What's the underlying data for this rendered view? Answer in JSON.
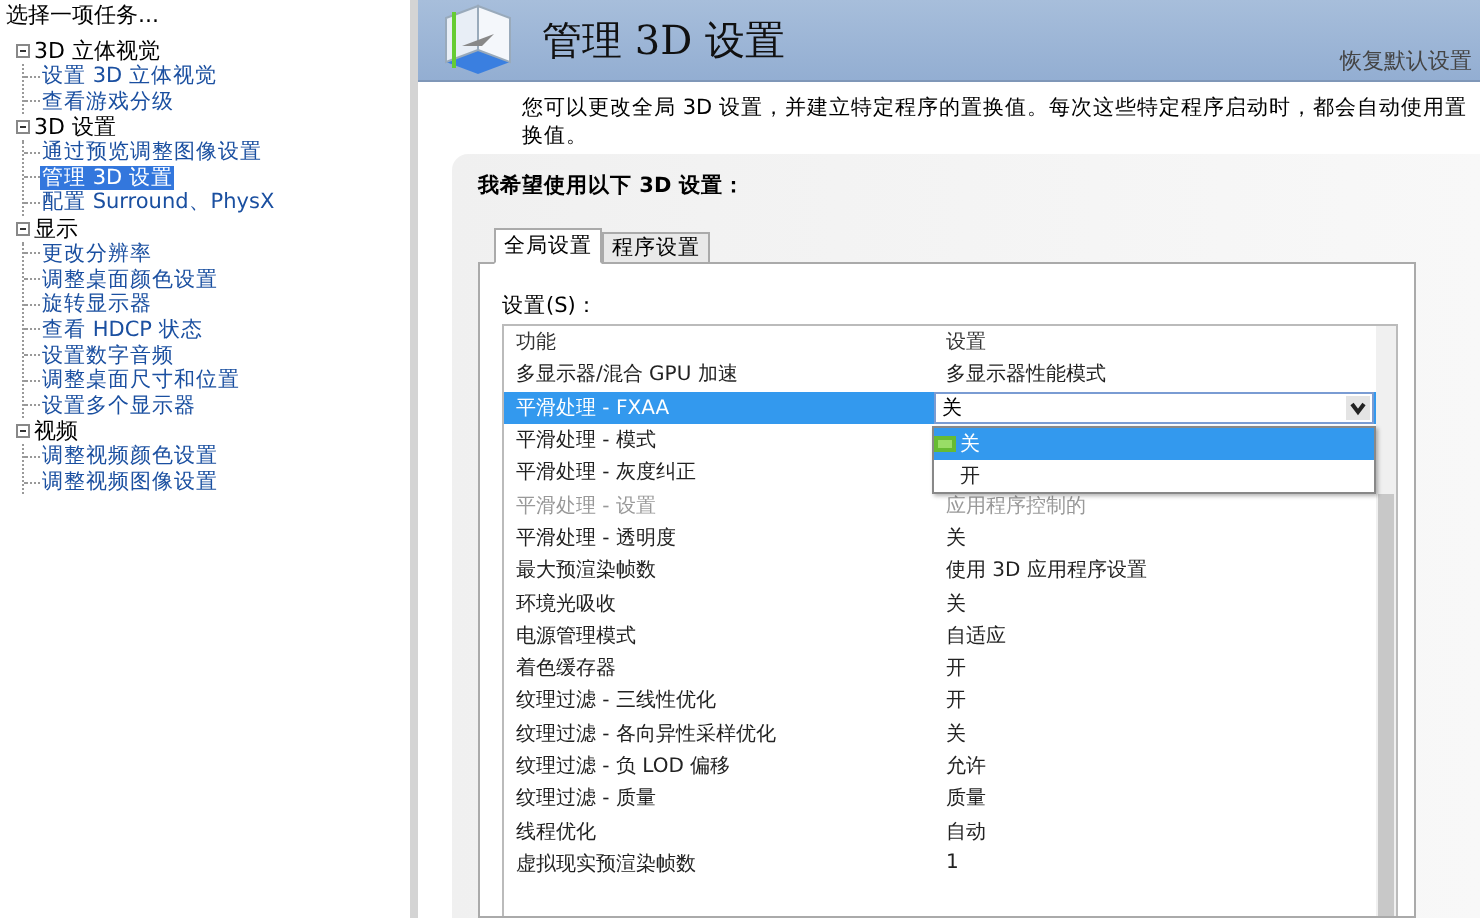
{
  "sidebar": {
    "title": "选择一项任务...",
    "tree": [
      {
        "label": "3D 立体视觉",
        "expanded": true,
        "children": [
          {
            "label": "设置 3D 立体视觉",
            "selected": false
          },
          {
            "label": "查看游戏分级",
            "selected": false
          }
        ]
      },
      {
        "label": "3D 设置",
        "expanded": true,
        "children": [
          {
            "label": "通过预览调整图像设置",
            "selected": false
          },
          {
            "label": "管理 3D 设置",
            "selected": true
          },
          {
            "label": "配置 Surround、PhysX",
            "selected": false
          }
        ]
      },
      {
        "label": "显示",
        "expanded": true,
        "children": [
          {
            "label": "更改分辨率",
            "selected": false
          },
          {
            "label": "调整桌面颜色设置",
            "selected": false
          },
          {
            "label": "旋转显示器",
            "selected": false
          },
          {
            "label": "查看 HDCP 状态",
            "selected": false
          },
          {
            "label": "设置数字音频",
            "selected": false
          },
          {
            "label": "调整桌面尺寸和位置",
            "selected": false
          },
          {
            "label": "设置多个显示器",
            "selected": false
          }
        ]
      },
      {
        "label": "视频",
        "expanded": true,
        "children": [
          {
            "label": "调整视频颜色设置",
            "selected": false
          },
          {
            "label": "调整视频图像设置",
            "selected": false
          }
        ]
      }
    ]
  },
  "header": {
    "title": "管理 3D 设置",
    "restore_link": "恢复默认设置"
  },
  "description": "您可以更改全局 3D 设置，并建立特定程序的置换值。每次这些特定程序启动时，都会自动使用置换值。",
  "group": {
    "title": "我希望使用以下 3D 设置：",
    "tabs": [
      {
        "label": "全局设置",
        "selected": true
      },
      {
        "label": "程序设置",
        "selected": false
      }
    ],
    "settings_label": "设置(S)：",
    "table": {
      "columns": [
        "功能",
        "设置"
      ],
      "rows": [
        {
          "feature": "多显示器/混合 GPU 加速",
          "setting": "多显示器性能模式",
          "selected": false,
          "disabled": false
        },
        {
          "feature": "平滑处理 - FXAA",
          "setting": "关",
          "selected": true,
          "disabled": false
        },
        {
          "feature": "平滑处理 - 模式",
          "selected": false,
          "disabled": false
        },
        {
          "feature": "平滑处理 - 灰度纠正",
          "selected": false,
          "disabled": false
        },
        {
          "feature": "平滑处理 - 设置",
          "setting": "应用程序控制的",
          "selected": false,
          "disabled": true
        },
        {
          "feature": "平滑处理 - 透明度",
          "setting": "关",
          "selected": false,
          "disabled": false
        },
        {
          "feature": "最大预渲染帧数",
          "setting": "使用 3D 应用程序设置",
          "selected": false,
          "disabled": false
        },
        {
          "feature": "环境光吸收",
          "setting": "关",
          "selected": false,
          "disabled": false
        },
        {
          "feature": "电源管理模式",
          "setting": "自适应",
          "selected": false,
          "disabled": false
        },
        {
          "feature": "着色缓存器",
          "setting": "开",
          "selected": false,
          "disabled": false
        },
        {
          "feature": "纹理过滤 - 三线性优化",
          "setting": "开",
          "selected": false,
          "disabled": false
        },
        {
          "feature": "纹理过滤 - 各向异性采样优化",
          "setting": "关",
          "selected": false,
          "disabled": false
        },
        {
          "feature": "纹理过滤 - 负 LOD 偏移",
          "setting": "允许",
          "selected": false,
          "disabled": false
        },
        {
          "feature": "纹理过滤 - 质量",
          "setting": "质量",
          "selected": false,
          "disabled": false
        },
        {
          "feature": "线程优化",
          "setting": "自动",
          "selected": false,
          "disabled": false
        },
        {
          "feature": "虚拟现实预渲染帧数",
          "setting": "1",
          "selected": false,
          "disabled": false
        }
      ],
      "dropdown": {
        "options": [
          {
            "label": "关",
            "selected": true
          },
          {
            "label": "开",
            "selected": false
          }
        ]
      }
    }
  }
}
